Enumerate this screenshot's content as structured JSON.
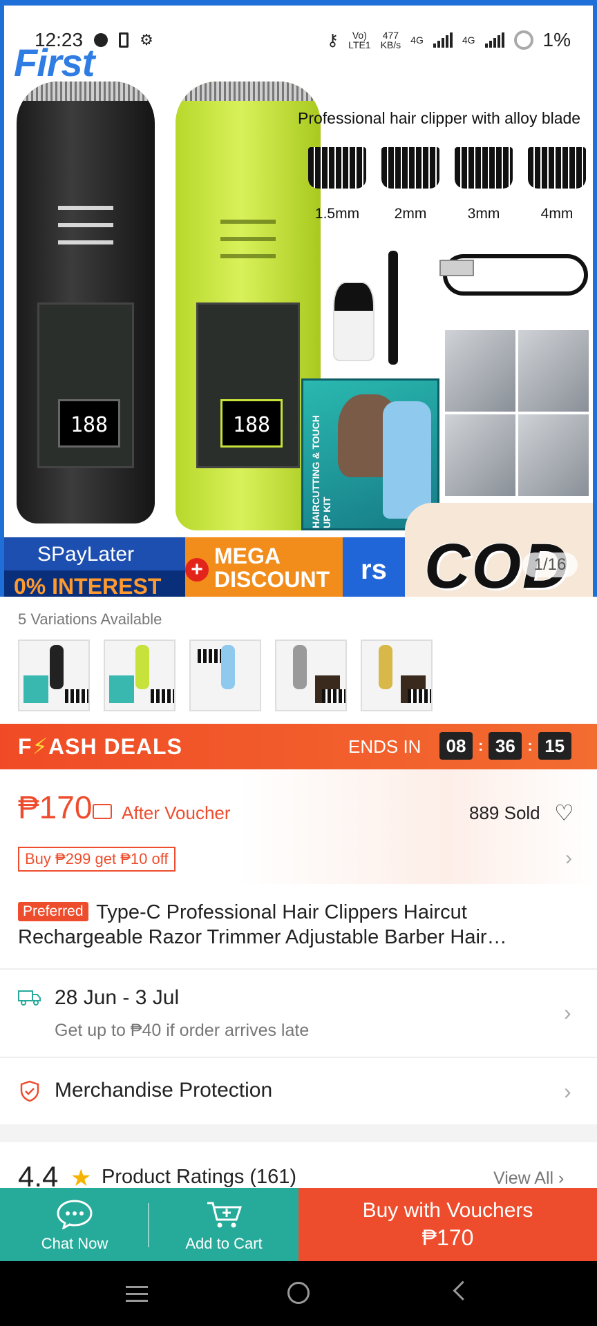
{
  "status_bar": {
    "time": "12:23",
    "net_speed_value": "477",
    "net_speed_unit": "KB/s",
    "net_type_1": "4G",
    "net_type_2": "4G",
    "volte_1": "Vo)",
    "volte_2": "LTE1",
    "battery": "1%"
  },
  "gallery": {
    "brand_logo_text": "First",
    "headline": "Professional hair clipper with alloy blade",
    "guard_sizes": [
      "1.5mm",
      "2mm",
      "3mm",
      "4mm"
    ],
    "led_display": "188",
    "box_side_text": "HAIRCUTTING & TOUCH UP KIT",
    "promo_spaylater": "SPayLater",
    "promo_interest": "0% INTEREST",
    "promo_plus": "+",
    "promo_mega": "MEGA",
    "promo_discount": "DISCOUNT",
    "promo_partial": "rs",
    "promo_cod": "COD",
    "counter": "1/16"
  },
  "variations": {
    "label": "5 Variations Available",
    "thumb_colors": [
      "#222222",
      "#c7e23a",
      "#8fc9ee",
      "#9a9a9a",
      "#d9b84a"
    ]
  },
  "flash_deals": {
    "title_prefix": "F",
    "title_bolt": "⚡",
    "title_suffix": "ASH DEALS",
    "ends_in_label": "ENDS IN",
    "hours": "08",
    "minutes": "36",
    "seconds": "15"
  },
  "price": {
    "amount": "₱170",
    "after_voucher": "After Voucher",
    "sold": "889 Sold",
    "promo": "Buy ₱299 get ₱10 off"
  },
  "product": {
    "badge": "Preferred",
    "title": "Type-C Professional Hair Clippers Haircut Rechargeable Razor Trimmer Adjustable Barber Hair…"
  },
  "shipping": {
    "date_range": "28 Jun - 3 Jul",
    "guarantee": "Get up to ₱40 if order arrives late"
  },
  "protection": {
    "label": "Merchandise Protection"
  },
  "ratings": {
    "score": "4.4",
    "label": "Product Ratings (161)",
    "view_all": "View All"
  },
  "action_bar": {
    "chat_label": "Chat Now",
    "cart_label": "Add to Cart",
    "buy_line1": "Buy with Vouchers",
    "buy_line2": "₱170"
  },
  "colors": {
    "accent": "#ee4d2d",
    "teal": "#26aa99",
    "flash": "#f04b26"
  }
}
